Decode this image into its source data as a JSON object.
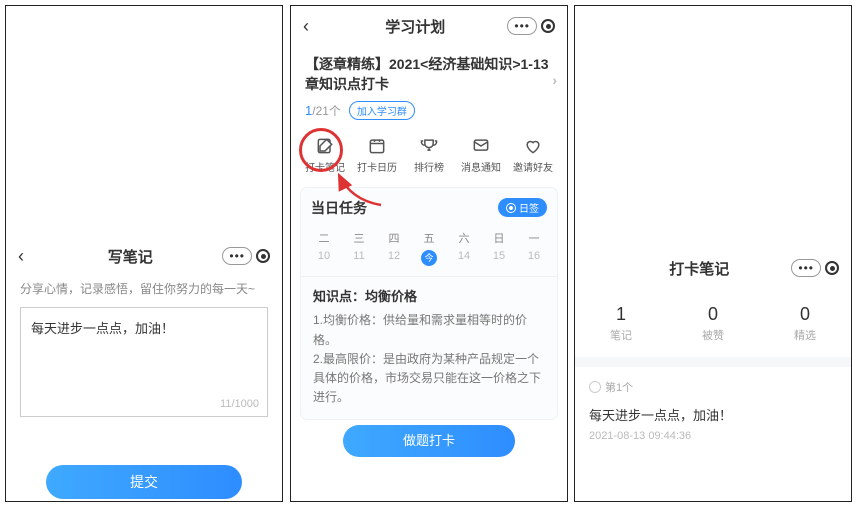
{
  "left": {
    "title": "写笔记",
    "subtitle": "分享心情，记录感悟，留住你努力的每一天~",
    "textarea_value": "每天进步一点点，加油！",
    "count": "11/1000",
    "submit": "提交"
  },
  "center": {
    "header": "学习计划",
    "plan_title": "【逐章精练】2021<经济基础知识>1-13章知识点打卡",
    "progress_current": "1",
    "progress_total": "/21个",
    "join_group": "加入学习群",
    "tools": [
      {
        "label": "打卡笔记"
      },
      {
        "label": "打卡日历"
      },
      {
        "label": "排行榜"
      },
      {
        "label": "消息通知"
      },
      {
        "label": "邀请好友"
      }
    ],
    "today_title": "当日任务",
    "badge": "日签",
    "days": [
      {
        "dw": "二",
        "dn": "10"
      },
      {
        "dw": "三",
        "dn": "11"
      },
      {
        "dw": "四",
        "dn": "12"
      },
      {
        "dw": "五",
        "dn": "今",
        "today": true
      },
      {
        "dw": "六",
        "dn": "14"
      },
      {
        "dw": "日",
        "dn": "15"
      },
      {
        "dw": "一",
        "dn": "16"
      }
    ],
    "knowledge_title": "知识点：均衡价格",
    "knowledge_body1": "1.均衡价格：供给量和需求量相等时的价格。",
    "knowledge_body2": "2.最高限价：是由政府为某种产品规定一个具体的价格，市场交易只能在这一价格之下进行。",
    "do_button": "做题打卡"
  },
  "right": {
    "title": "打卡笔记",
    "stats": [
      {
        "n": "1",
        "l": "笔记"
      },
      {
        "n": "0",
        "l": "被赞"
      },
      {
        "n": "0",
        "l": "精选"
      }
    ],
    "item_tag": "第1个",
    "item_text": "每天进步一点点，加油！",
    "item_time": "2021-08-13 09:44:36"
  }
}
